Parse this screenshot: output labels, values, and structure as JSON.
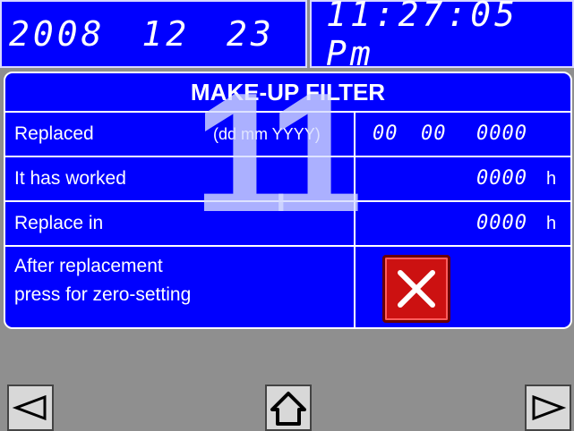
{
  "header": {
    "date": "2008 12 23",
    "time": "11:27:05 Pm"
  },
  "panel": {
    "title": "MAKE-UP FILTER",
    "watermark": "11",
    "rows": [
      {
        "label": "Replaced",
        "hint": "(dd mm YYYY)",
        "day": "00",
        "month": "00",
        "year": "0000"
      },
      {
        "label": "It has worked",
        "value": "0000",
        "unit": "h"
      },
      {
        "label": "Replace in",
        "value": "0000",
        "unit": "h"
      },
      {
        "label_line1": "After replacement",
        "label_line2": "press for zero-setting"
      }
    ]
  },
  "colors": {
    "panel": "#0000ff",
    "reset_button": "#cc1111",
    "background": "#8f8f8f"
  },
  "nav": {
    "left": "arrow-left-icon",
    "home": "home-icon",
    "right": "arrow-right-icon"
  }
}
